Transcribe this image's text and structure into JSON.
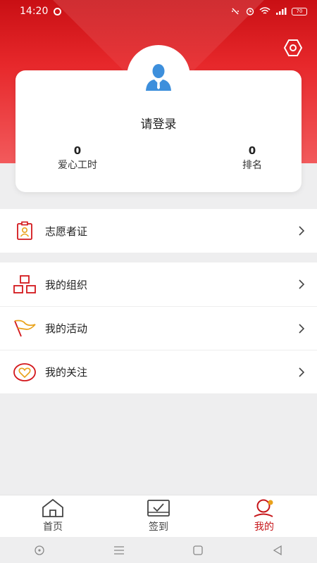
{
  "status_bar": {
    "time": "14:20",
    "battery": "70"
  },
  "profile": {
    "login_prompt": "请登录",
    "volunteer_hours_value": "0",
    "volunteer_hours_label": "爱心工时",
    "rank_value": "0",
    "rank_label": "排名"
  },
  "menu": {
    "certificate": "志愿者证",
    "my_organization": "我的组织",
    "my_activities": "我的活动",
    "my_follows": "我的关注"
  },
  "tabs": [
    {
      "label": "首页",
      "icon": "home-icon"
    },
    {
      "label": "签到",
      "icon": "check-in-icon"
    },
    {
      "label": "我的",
      "icon": "profile-icon"
    }
  ],
  "active_tab": "我的",
  "colors": {
    "brand_red": "#d3171b",
    "icon_orange": "#e9a21a",
    "background": "#eeeeef"
  }
}
